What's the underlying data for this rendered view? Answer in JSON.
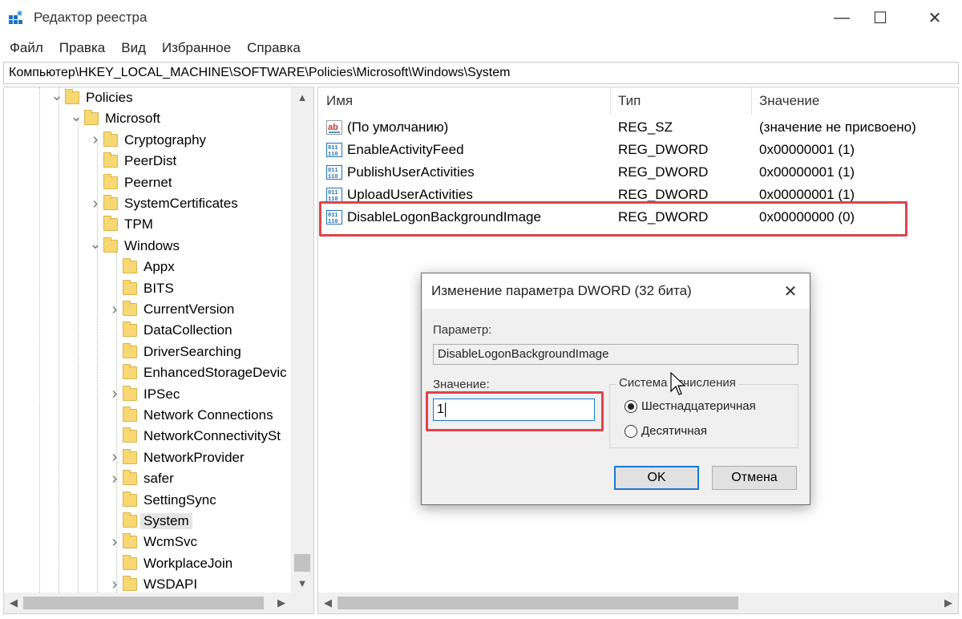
{
  "window": {
    "title": "Редактор реестра",
    "icon": "registry-editor-icon",
    "controls": {
      "minimize": "—",
      "maximize": "☐",
      "close": "✕"
    }
  },
  "menu": [
    "Файл",
    "Правка",
    "Вид",
    "Избранное",
    "Справка"
  ],
  "address": "Компьютер\\HKEY_LOCAL_MACHINE\\SOFTWARE\\Policies\\Microsoft\\Windows\\System",
  "tree": {
    "items": [
      {
        "label": "Policies",
        "chevron": "expanded"
      },
      {
        "label": "Microsoft",
        "chevron": "expanded"
      },
      {
        "label": "Cryptography",
        "chevron": "collapsed"
      },
      {
        "label": "PeerDist",
        "chevron": "none"
      },
      {
        "label": "Peernet",
        "chevron": "none"
      },
      {
        "label": "SystemCertificates",
        "chevron": "collapsed"
      },
      {
        "label": "TPM",
        "chevron": "none"
      },
      {
        "label": "Windows",
        "chevron": "expanded"
      },
      {
        "label": "Appx",
        "chevron": "none"
      },
      {
        "label": "BITS",
        "chevron": "none"
      },
      {
        "label": "CurrentVersion",
        "chevron": "collapsed"
      },
      {
        "label": "DataCollection",
        "chevron": "none"
      },
      {
        "label": "DriverSearching",
        "chevron": "none"
      },
      {
        "label": "EnhancedStorageDevic",
        "chevron": "none"
      },
      {
        "label": "IPSec",
        "chevron": "collapsed"
      },
      {
        "label": "Network Connections",
        "chevron": "none"
      },
      {
        "label": "NetworkConnectivitySt",
        "chevron": "none"
      },
      {
        "label": "NetworkProvider",
        "chevron": "collapsed"
      },
      {
        "label": "safer",
        "chevron": "collapsed"
      },
      {
        "label": "SettingSync",
        "chevron": "none"
      },
      {
        "label": "System",
        "chevron": "none",
        "selected": true
      },
      {
        "label": "WcmSvc",
        "chevron": "collapsed"
      },
      {
        "label": "WorkplaceJoin",
        "chevron": "none"
      },
      {
        "label": "WSDAPI",
        "chevron": "collapsed"
      }
    ]
  },
  "values": {
    "columns": {
      "name": "Имя",
      "type": "Тип",
      "value": "Значение"
    },
    "rows": [
      {
        "icon": "string-value-icon",
        "name": "(По умолчанию)",
        "type": "REG_SZ",
        "value": "(значение не присвоено)"
      },
      {
        "icon": "dword-value-icon",
        "name": "EnableActivityFeed",
        "type": "REG_DWORD",
        "value": "0x00000001 (1)"
      },
      {
        "icon": "dword-value-icon",
        "name": "PublishUserActivities",
        "type": "REG_DWORD",
        "value": "0x00000001 (1)"
      },
      {
        "icon": "dword-value-icon",
        "name": "UploadUserActivities",
        "type": "REG_DWORD",
        "value": "0x00000001 (1)"
      },
      {
        "icon": "dword-value-icon",
        "name": "DisableLogonBackgroundImage",
        "type": "REG_DWORD",
        "value": "0x00000000 (0)"
      }
    ]
  },
  "dialog": {
    "title": "Изменение параметра DWORD (32 бита)",
    "param_label": "Параметр:",
    "param_value": "DisableLogonBackgroundImage",
    "value_label": "Значение:",
    "value": "1",
    "base_group_label": "Система исчисления",
    "radio_hex": "Шестнадцатеричная",
    "radio_dec": "Десятичная",
    "selected_base": "hex",
    "ok": "OK",
    "cancel": "Отмена"
  },
  "colors": {
    "highlight": "#e0434b",
    "focus": "#1b78d0",
    "folder": "#f7d873"
  }
}
